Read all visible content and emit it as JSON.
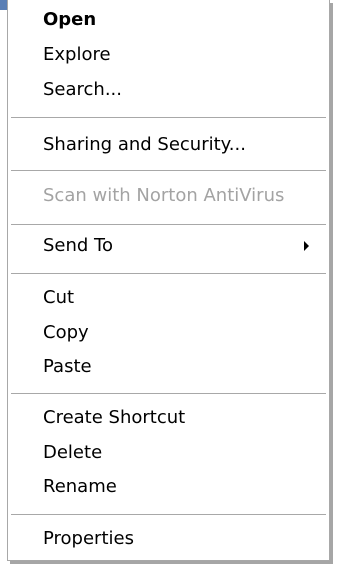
{
  "context_menu": {
    "items": [
      {
        "label": "Open"
      },
      {
        "label": "Explore"
      },
      {
        "label": "Search..."
      },
      {
        "label": "Sharing and Security..."
      },
      {
        "label": "Scan with Norton AntiVirus"
      },
      {
        "label": "Send To",
        "submenu_icon": "submenu-arrow-icon"
      },
      {
        "label": "Cut"
      },
      {
        "label": "Copy"
      },
      {
        "label": "Paste"
      },
      {
        "label": "Create Shortcut"
      },
      {
        "label": "Delete"
      },
      {
        "label": "Rename"
      },
      {
        "label": "Properties"
      }
    ],
    "disabled_text_color": "#a3a3a3"
  }
}
